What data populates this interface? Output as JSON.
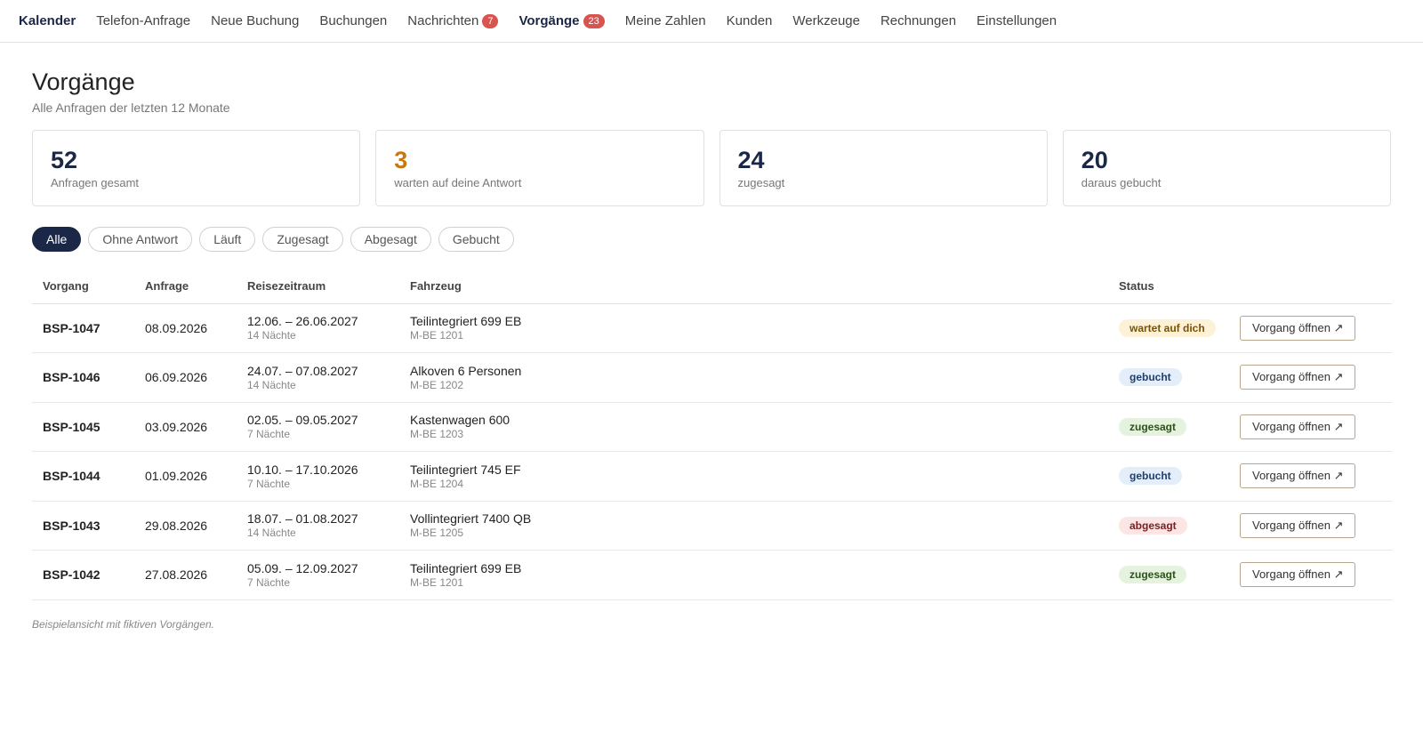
{
  "nav": {
    "brand": "Kalender",
    "items": [
      {
        "label": "Telefon-Anfrage"
      },
      {
        "label": "Neue Buchung"
      },
      {
        "label": "Buchungen"
      },
      {
        "label": "Nachrichten",
        "badge": "7"
      },
      {
        "label": "Vorgänge",
        "badge": "23"
      },
      {
        "label": "Meine Zahlen"
      },
      {
        "label": "Kunden"
      },
      {
        "label": "Werkzeuge"
      },
      {
        "label": "Rechnungen"
      },
      {
        "label": "Einstellungen"
      }
    ]
  },
  "page": {
    "title": "Vorgänge",
    "subtitle": "Alle Anfragen der letzten 12 Monate"
  },
  "stats": [
    {
      "value": "52",
      "label": "Anfragen gesamt"
    },
    {
      "value": "3",
      "label": "warten auf deine Antwort"
    },
    {
      "value": "24",
      "label": "zugesagt"
    },
    {
      "value": "20",
      "label": "daraus gebucht"
    }
  ],
  "filters": [
    "Alle",
    "Ohne Antwort",
    "Läuft",
    "Zugesagt",
    "Abgesagt",
    "Gebucht"
  ],
  "table": {
    "headers": [
      "Vorgang",
      "Anfrage",
      "Reisezeitraum",
      "Fahrzeug",
      "Status"
    ],
    "button_label": "Vorgang öffnen ↗",
    "rows": [
      {
        "id": "BSP-1047",
        "date": "08.09.2026",
        "period": "12.06. – 26.06.2027",
        "nights": "14 Nächte",
        "vehicle": "Teilintegriert 699 EB",
        "plate": "M-BE 1201",
        "status": "wartet auf dich"
      },
      {
        "id": "BSP-1046",
        "date": "06.09.2026",
        "period": "24.07. – 07.08.2027",
        "nights": "14 Nächte",
        "vehicle": "Alkoven 6 Personen",
        "plate": "M-BE 1202",
        "status": "gebucht"
      },
      {
        "id": "BSP-1045",
        "date": "03.09.2026",
        "period": "02.05. – 09.05.2027",
        "nights": "7 Nächte",
        "vehicle": "Kastenwagen 600",
        "plate": "M-BE 1203",
        "status": "zugesagt"
      },
      {
        "id": "BSP-1044",
        "date": "01.09.2026",
        "period": "10.10. – 17.10.2026",
        "nights": "7 Nächte",
        "vehicle": "Teilintegriert 745 EF",
        "plate": "M-BE 1204",
        "status": "gebucht"
      },
      {
        "id": "BSP-1043",
        "date": "29.08.2026",
        "period": "18.07. – 01.08.2027",
        "nights": "14 Nächte",
        "vehicle": "Vollintegriert 7400 QB",
        "plate": "M-BE 1205",
        "status": "abgesagt"
      },
      {
        "id": "BSP-1042",
        "date": "27.08.2026",
        "period": "05.09. – 12.09.2027",
        "nights": "7 Nächte",
        "vehicle": "Teilintegriert 699 EB",
        "plate": "M-BE 1201",
        "status": "zugesagt"
      }
    ]
  },
  "footnote": "Beispielansicht mit fiktiven Vorgängen.",
  "colors": {
    "brand": "#1b2747",
    "badge": "#d9534f",
    "warn": "#c8780c"
  }
}
